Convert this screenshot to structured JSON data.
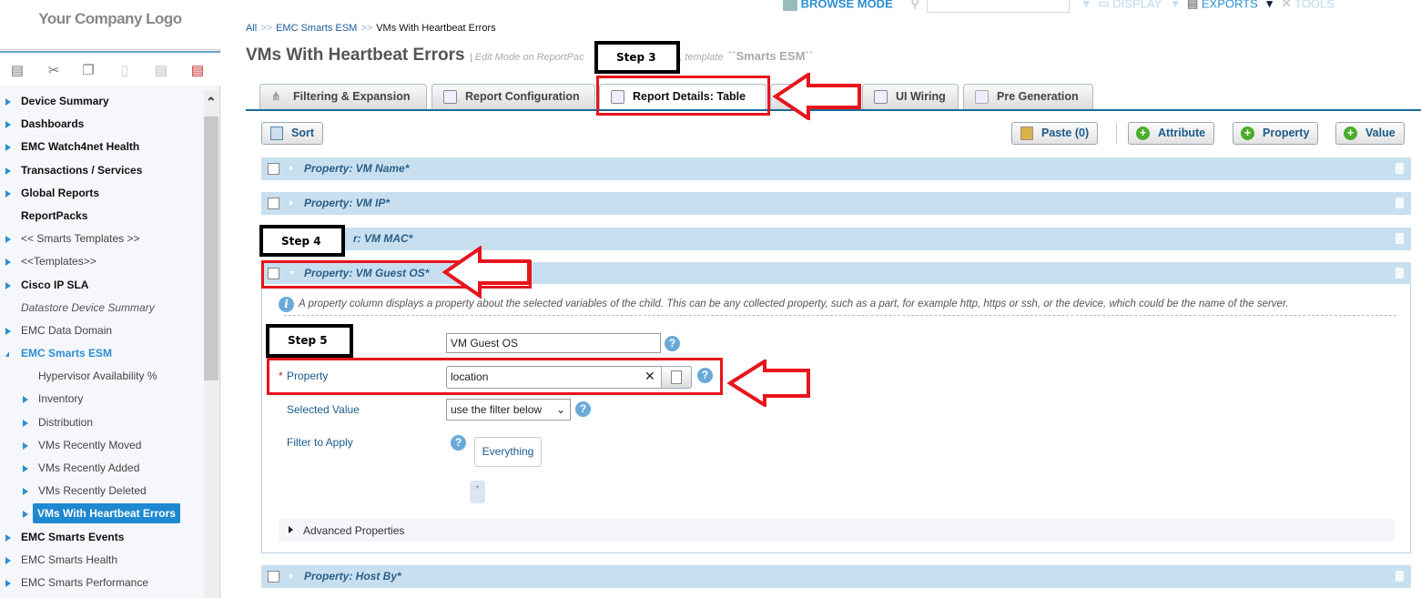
{
  "logo": "Your Company Logo",
  "topbar": {
    "browse_mode": "BROWSE MODE",
    "display": "DISPLAY",
    "exports": "EXPORTS",
    "tools": "TOOLS",
    "search_placeholder": ""
  },
  "sidebar": {
    "items": [
      {
        "label": "Device Summary"
      },
      {
        "label": "Dashboards"
      },
      {
        "label": "EMC Watch4net Health"
      },
      {
        "label": "Transactions / Services"
      },
      {
        "label": "Global Reports"
      },
      {
        "label": "ReportPacks"
      },
      {
        "label": "<< Smarts Templates >>"
      },
      {
        "label": "<<Templates>>"
      },
      {
        "label": "Cisco IP SLA"
      },
      {
        "label": "Datastore Device Summary"
      },
      {
        "label": "EMC Data Domain"
      },
      {
        "label": "EMC Smarts ESM"
      },
      {
        "label": "Hypervisor Availability %"
      },
      {
        "label": "Inventory"
      },
      {
        "label": "Distribution"
      },
      {
        "label": "VMs Recently Moved"
      },
      {
        "label": "VMs Recently Added"
      },
      {
        "label": "VMs Recently Deleted"
      },
      {
        "label": "VMs With Heartbeat Errors"
      },
      {
        "label": "EMC Smarts Events"
      },
      {
        "label": "EMC Smarts Health"
      },
      {
        "label": "EMC Smarts Performance"
      }
    ]
  },
  "breadcrumb": {
    "all": "All",
    "sep": ">>",
    "parent": "EMC Smarts ESM",
    "current": "VMs With Heartbeat Errors"
  },
  "title": "VMs With Heartbeat Errors",
  "subtitle": "| Edit Mode on ReportPac",
  "subtitle_end": "s'', template",
  "template": "``Smarts ESM``",
  "tabs": [
    {
      "label": "Filtering & Expansion"
    },
    {
      "label": "Report Configuration"
    },
    {
      "label": "Report Details: Table"
    },
    {
      "label": ""
    },
    {
      "label": "UI Wiring"
    },
    {
      "label": "Pre Generation"
    }
  ],
  "toolbar": {
    "sort": "Sort",
    "paste": "Paste (0)",
    "attribute": "Attribute",
    "property": "Property",
    "value": "Value"
  },
  "rows": [
    {
      "label": "Property: VM Name*"
    },
    {
      "label": "Property: VM IP*"
    },
    {
      "label": "r: VM MAC*"
    },
    {
      "label": "Property: VM Guest OS*"
    },
    {
      "label": "Property: Host By*"
    }
  ],
  "panel": {
    "info": "A property column displays a property about the selected variables of the child. This can be any collected property, such as a part, for example http, https or ssh, or the device, which could be the name of the server.",
    "name_value": "VM Guest OS",
    "property_label": "Property",
    "required": "*",
    "property_value": "location",
    "selected_value_label": "Selected Value",
    "selected_value": "use the filter below",
    "filter_label": "Filter to Apply",
    "filter_value": "Everything",
    "star": "*",
    "advanced": "Advanced Properties"
  },
  "annotations": {
    "step3": "Step 3",
    "step4": "Step 4",
    "step5": "Step 5"
  }
}
